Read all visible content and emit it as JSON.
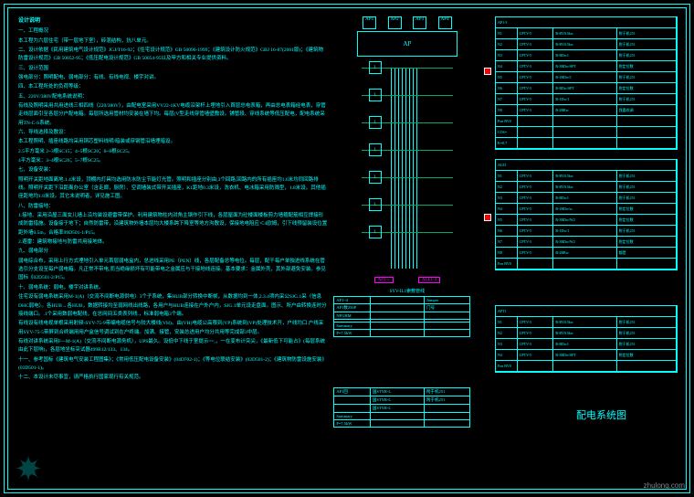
{
  "header": "设计说明",
  "specs": [
    "一、工程概况",
    "本工程为六层住宅（带一层地下室），砖混结构，抗八单元。",
    "二、设计依据《民用建筑电气设计规范》JGJ/T16-92；《住宅设计规范》GB 50096-1999；《建筑设计防火规范》GBJ 16-87(2001版)；《建筑物防雷设计规范》GB 50052-95；《低压配电设计规范》GB 50054-95以及甲方和相关专业提供资料。",
    "三、设计范围",
    "强电部分：照明配电、弱电部分：有线、有线电视、楼宇对讲。",
    "四、本工程所处的负荷等级：",
    "五、220V/380V配电系统说明：",
    "有线及照明采用共用进线三相四线（220/380V），由配电室采用VV22-1KV电缆沿架杆上埋地引入首层总电表箱，再由总电表箱经电表，穿管走线层面引至各层分户配电箱。每层所选用管材均安装在墙下均。每层(V型走线穿管墙壁敷设。铺管段、穿线系统等低压配电，配电系统采用TN-C-S系统。",
    "六、导线选择及敷设：",
    "本工程照明、插座线路均采用铜芯塑料线明/暗装或穿钢管沿墙埋暗设。",
    "2.5平方毫米 2~3根SC15；4~5根SC20；6~8根SC25。",
    "4平方毫米：3~4根SC20；5~7根SC25。",
    "七、设备安装：",
    "照明开关距地面离地.1.4米设，顶棚内灯具均选用防水防尘节能灯光管。照明和插座分别由,3个回路,回路内的所有插座均1.6米均同回路排线。照明开关距下沿距离办公室（含走廊，厨房）、空调墙装式带开关插座，K1距地0.3米设，洗衣机、电冰箱采用防溅型，1.8米设。其他插座距地均1.8米设。其它未说明者，详见施工图。",
    "八、防雷接地：",
    "1.接地、采用沿屋三面女儿墙上沿均装设避雷带保护。利用建筑物柱内对角主钢作引下线，各层屋面为砼楼面楼板剪力墙箍配筋相互焊接形成防雷措施。设备接于地下；自然防雷带，沿建筑物外墙本层均大楼系跨下降室等地方沟敷设，保接地电阻应＜4欧姆，引下线预留装设位置距外墙0.5m，合格率99D501-1/P15。",
    "2.避雷：建筑物接地与防雷共用接地体。",
    "九、弱电部分",
    "弱电综合布，采用上行方式埋地引入单元首层弱电盒内，总进线采用PE（PEN）线，各层配备总等电位。每层，配干每户单独进线系统在管选引分支设至每户弱电箱。凡正常不带电,而当绝缘损坏有可能带电之金属应与干接地线连接。基本要求：金属外壳，其外部避免安装。参见国标《02D501-2/P15。",
    "十、弱电系统：弱电，楼宇对讲系统。",
    "住宅设有弱电系统采用M-1(A)（交流不间断电源供电）3个子系统，集HUB部分转换中断帧，从数据均到一体,2.3.4项内采公SJG.1采（信息DHC弱电）。各HUB→各HUB，数据转接均至弱网线出线路，各用户与HUB连接在户外户内，SJG.1单元设走盘面。图示、所户由转换连时分接线端口。.1个采用数弱电配线，在总网间五类表列线.，标准弱电箱3个端。",
    "有线设有线电视单根采用射频-SYV-75-9带编电缆信号与较大楼线(VH)。由(VH)电缆公高限到(VP)系统到(VP)处理技术开，户线均口.户线采用SYV-75-5带屏到合终端用用户盒信号调试到在户终端。加满、接管，安装总进用户均分共用等完成部3中层。",
    "有线对讲系统采用F~-M-1(A)（交流不间断电源务机），UPS最久。设低中下线于室提示==,，一在变布计突尖，《最新低下可能占》(每层系统由此下层响)，各层地坐标突试器499B12/133、134。",
    "十一、参考国标《建筑电气安装工程图集》；《常用低压配电设备安装》(04D702-1)；《等电位联结安装》(02D501-2)；《建筑物防雷设施安装》(03D501-1)。",
    "十二、本设计未尽事宜，请严格执行国家现行有关规范。"
  ],
  "ap": {
    "label": "AP",
    "tops": [
      "AP1",
      "AP2",
      "AP3",
      "AP4"
    ]
  },
  "riser": {
    "floors": [
      "L",
      "L",
      "L",
      "L",
      "L",
      "L",
      "L"
    ],
    "bottom": [
      "AP1-5",
      "ALE1-4"
    ],
    "label": "SYV-IL1索敷管线"
  },
  "tables": {
    "t1": [
      [
        "AP1~4",
        "",
        "Jumper"
      ],
      [
        "AP1数256P",
        "",
        "门号"
      ],
      [
        "NFGHM",
        "",
        ""
      ],
      [
        "",
        "",
        ""
      ],
      [
        "Summary",
        "",
        ""
      ],
      [
        "P=7.5kW",
        "",
        ""
      ]
    ],
    "t2": [
      [
        "AP1回",
        "国STYR-L",
        "附于机251"
      ],
      [
        "",
        "国STYR-L",
        "附于机251"
      ],
      [
        "",
        "国STYR-L",
        ""
      ],
      [
        "Summary",
        "",
        ""
      ],
      [
        "P=7.5kW",
        "",
        ""
      ]
    ]
  },
  "panels": {
    "p1": {
      "header": "AP1-3",
      "rows": [
        [
          "N1",
          "CPTV-5",
          "B-BV0.5kw",
          "附于机251"
        ],
        [
          "N2",
          "CPTV-5",
          "B-BV0.5kw",
          "附于机251"
        ],
        [
          "N3",
          "CPTV-5",
          "B-BDw1",
          "附于机251"
        ],
        [
          "N4",
          "CPTV-5",
          "B-3BDw/SPT",
          "附定位数"
        ],
        [
          "N5",
          "CPTV-5",
          "B-1BDw/1",
          "附于机251"
        ],
        [
          "N6",
          "CPTV-5",
          "B-RDw/SPT",
          "附定位数"
        ],
        [
          "N7",
          "CPTV-5",
          "B-1Dw/1",
          "附于机251"
        ],
        [
          "N8",
          "CPTV-5",
          "B-2BRw",
          "我喜欢调"
        ],
        [
          "Pon BV0",
          "",
          "",
          ""
        ],
        [
          "COS=",
          "",
          "",
          ""
        ],
        [
          "K=0.7",
          "",
          "",
          ""
        ]
      ]
    },
    "p2": {
      "header": "ALE1",
      "rows": [
        [
          "N1",
          "CPTV-5",
          "B-BV0.5kw",
          "附于机251"
        ],
        [
          "N2",
          "CPTV-5",
          "B-BV0.5kw",
          "附于机251"
        ],
        [
          "N3",
          "CPTV-5",
          "B-BDw1",
          "附于机251"
        ],
        [
          "N4",
          "CPTV-5",
          "B-1BDw/w",
          "附定位数"
        ],
        [
          "N5",
          "CPTV-5",
          "B-3BDw/W2",
          "附定位数"
        ],
        [
          "N6",
          "CPTV-5",
          "B-1Dw/1",
          "附于机251"
        ],
        [
          "N7",
          "CPTV-5",
          "B-3BDw/W2",
          "附定位数"
        ],
        [
          "N8",
          "CPTV-5",
          "B-2BRw",
          "都是"
        ],
        [
          "Pon BV0",
          "",
          "",
          ""
        ]
      ]
    },
    "p3": {
      "header": "APT1",
      "rows": [
        [
          "N1",
          "CPTV-5",
          "B-BV0.5kw",
          "附于机251"
        ],
        [
          "N2",
          "CPTV-5",
          "B-BV0.5kw",
          "附于机251"
        ],
        [
          "N3",
          "CPTV-5",
          "B-BDw1",
          "附于机251"
        ],
        [
          "N4",
          "CPTV-5",
          "B-3BDw/SPT",
          "附定位数"
        ],
        [
          "Pon BV0",
          "",
          "",
          ""
        ]
      ]
    }
  },
  "title": "配电系统图",
  "watermark": "zhulong.com"
}
